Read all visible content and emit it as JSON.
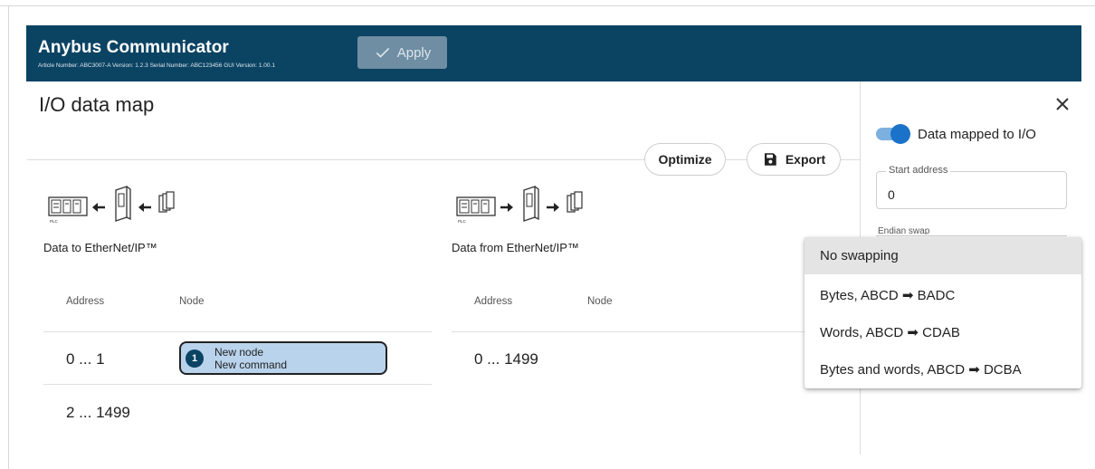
{
  "header": {
    "title": "Anybus Communicator",
    "meta": "Article Number: ABC3007-A Version: 1.2.3 Serial Number: ABC123456 GUI Version: 1.00.1",
    "apply_label": "Apply",
    "bg_color": "#0b4363"
  },
  "page": {
    "title": "I/O data map",
    "optimize_label": "Optimize",
    "export_label": "Export"
  },
  "to_ethernet": {
    "label": "Data to EtherNet/IP™",
    "col_address": "Address",
    "col_node": "Node",
    "rows": [
      {
        "address": "0 ... 1",
        "node_index": "1",
        "node_name": "New node",
        "node_command": "New command"
      },
      {
        "address": "2 ... 1499"
      }
    ]
  },
  "from_ethernet": {
    "label": "Data from EtherNet/IP™",
    "col_address": "Address",
    "col_node": "Node",
    "rows": [
      {
        "address": "0 ... 1499"
      }
    ]
  },
  "side_panel": {
    "toggle_label": "Data mapped to I/O",
    "toggle_on": true,
    "start_address_label": "Start address",
    "start_address_value": "0",
    "endian_label": "Endian swap",
    "endian_options": [
      {
        "label": "No swapping",
        "selected": true
      },
      {
        "label": "Bytes, ABCD ➡ BADC",
        "selected": false
      },
      {
        "label": "Words, ABCD ➡ CDAB",
        "selected": false
      },
      {
        "label": "Bytes and words, ABCD ➡ DCBA",
        "selected": false
      }
    ]
  },
  "icons": {
    "apply": "check-icon",
    "export": "save-icon",
    "close": "close-icon",
    "plc": "plc-icon",
    "gateway": "gateway-icon",
    "devices": "devices-icon"
  }
}
